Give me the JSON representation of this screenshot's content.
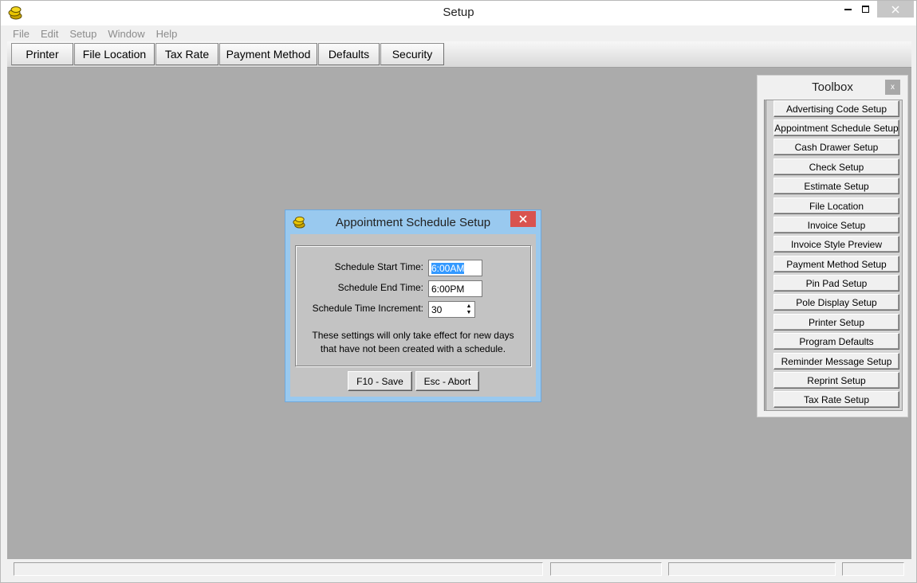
{
  "window": {
    "title": "Setup"
  },
  "menu": [
    "File",
    "Edit",
    "Setup",
    "Window",
    "Help"
  ],
  "toolbar": [
    "Printer",
    "File Location",
    "Tax Rate",
    "Payment Method",
    "Defaults",
    "Security"
  ],
  "toolbox": {
    "title": "Toolbox",
    "close": "x",
    "items": [
      "Advertising Code Setup",
      "Appointment Schedule Setup",
      "Cash Drawer Setup",
      "Check Setup",
      "Estimate Setup",
      "File Location",
      "Invoice Setup",
      "Invoice Style Preview",
      "Payment Method Setup",
      "Pin Pad Setup",
      "Pole Display Setup",
      "Printer Setup",
      "Program Defaults",
      "Reminder Message Setup",
      "Reprint Setup",
      "Tax Rate Setup"
    ]
  },
  "dialog": {
    "title": "Appointment Schedule Setup",
    "start_label": "Schedule Start Time:",
    "start_value": "6:00AM",
    "end_label": "Schedule End Time:",
    "end_value": "6:00PM",
    "increment_label": "Schedule Time Increment:",
    "increment_value": "30",
    "note_line1": "These settings will only take effect for new days",
    "note_line2": "that have not been created with a schedule.",
    "save_label": "F10 - Save",
    "abort_label": "Esc - Abort"
  },
  "colors": {
    "mdi_background": "#ababab",
    "dialog_frame": "#99c9ef",
    "close_red": "#d9534f"
  }
}
